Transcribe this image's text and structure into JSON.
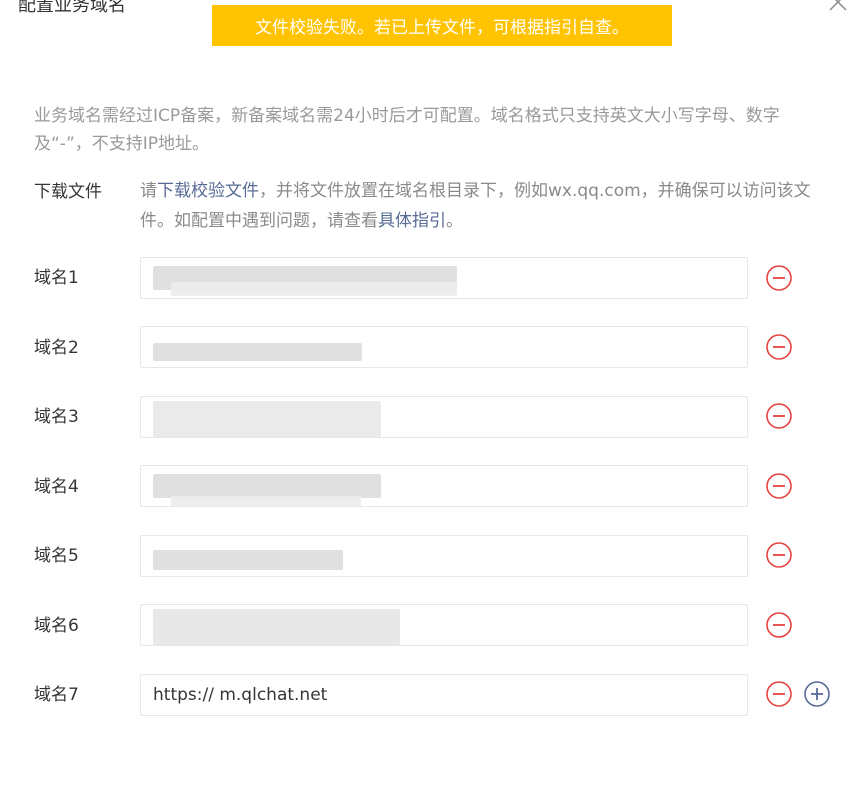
{
  "dialog": {
    "title": "配置业务域名",
    "toast": "文件校验失败。若已上传文件，可根据指引自查。",
    "description": "业务域名需经过ICP备案，新备案域名需24小时后才可配置。域名格式只支持英文大小写字母、数字及“-”，不支持IP地址。"
  },
  "download": {
    "label": "下载文件",
    "text_prefix": "请",
    "link_download": "下载校验文件",
    "text_middle": "，并将文件放置在域名根目录下，例如wx.qq.com，并确保可以访问该文件。如配置中遇到问题，请查看",
    "link_guide": "具体指引",
    "text_suffix": "。"
  },
  "domains": [
    {
      "label": "域名1",
      "value": ""
    },
    {
      "label": "域名2",
      "value": ""
    },
    {
      "label": "域名3",
      "value": ""
    },
    {
      "label": "域名4",
      "value": ""
    },
    {
      "label": "域名5",
      "value": ""
    },
    {
      "label": "域名6",
      "value": ""
    },
    {
      "label": "域名7",
      "value": "https:// m.qlchat.net"
    }
  ],
  "colors": {
    "toast_bg": "#ffc300",
    "link": "#576b95",
    "remove_icon": "#e64340",
    "add_icon": "#576b95"
  },
  "icons": {
    "close": "close-icon",
    "remove": "minus-circle-icon",
    "add": "plus-circle-icon"
  }
}
